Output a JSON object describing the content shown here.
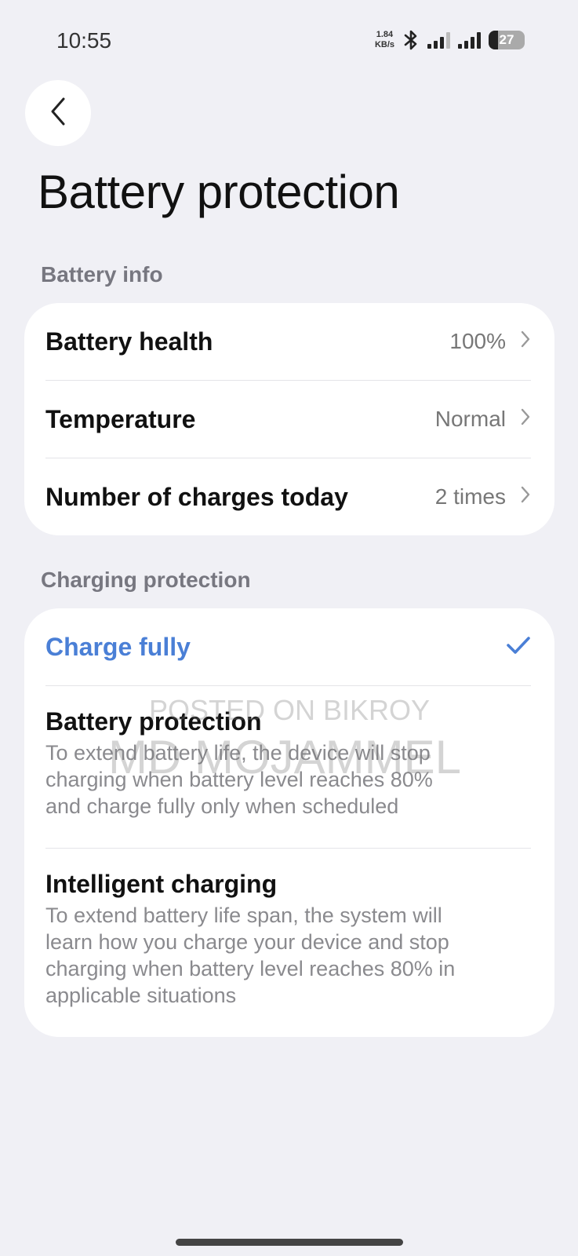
{
  "status_bar": {
    "time": "10:55",
    "net_speed_value": "1.84",
    "net_speed_unit": "KB/s",
    "battery_level": "27",
    "battery_fraction": 0.27
  },
  "page": {
    "title": "Battery protection"
  },
  "battery_info": {
    "header": "Battery info",
    "items": [
      {
        "label": "Battery health",
        "value": "100%"
      },
      {
        "label": "Temperature",
        "value": "Normal"
      },
      {
        "label": "Number of charges today",
        "value": "2 times"
      }
    ]
  },
  "charging_protection": {
    "header": "Charging protection",
    "options": [
      {
        "title": "Charge fully",
        "description": "",
        "selected": true
      },
      {
        "title": "Battery protection",
        "description_lines": [
          "To extend battery life, the device will stop",
          "charging when battery level reaches 80%",
          "and charge fully only when scheduled"
        ],
        "selected": false
      },
      {
        "title": "Intelligent charging",
        "description_lines": [
          "To extend battery life span, the system will",
          "learn how you charge your device and stop",
          "charging when battery level reaches 80% in",
          "applicable situations"
        ],
        "selected": false
      }
    ]
  },
  "watermark": {
    "line1": "POSTED ON BIKROY",
    "line2": "MD MOJAMMEL"
  },
  "colors": {
    "accent": "#4a7fd6",
    "background": "#f0f0f5",
    "card": "#ffffff"
  },
  "icons": {
    "back": "chevron-left-icon",
    "chevron": "chevron-right-icon",
    "check": "check-icon",
    "bluetooth": "bluetooth-icon",
    "signal": "signal-icon",
    "battery": "battery-icon"
  }
}
